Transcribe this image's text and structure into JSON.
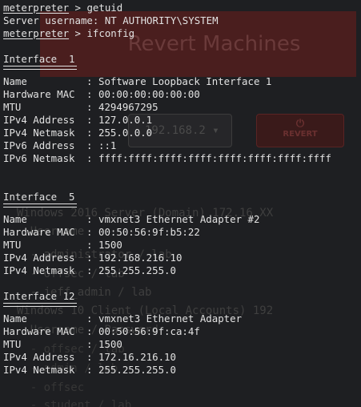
{
  "background": {
    "banner_title": "Revert Machines",
    "dropdown_value": "192.168.2",
    "revert_label": "REVERT",
    "lines": [
      "  Windows 2016 Server (Domain) 172.16.XX",
      "    Username",
      "    - administrator / lab",
      "    - offsec / lab",
      "    - jeff_admin / lab",
      "  Windows 10 Client (Local Accounts) 192",
      "    Username / Password",
      "    - offsec / lab",
      "    - admin / lab",
      "    - offsec",
      "    - student / lab"
    ],
    "colors": {
      "page": "#1e1f22",
      "banner": "#4a1e1e",
      "revert": "#3a1a1a"
    }
  },
  "terminal": {
    "prompt": "meterpreter",
    "commands": {
      "getuid": " > getuid",
      "ifconfig": " > ifconfig"
    },
    "getuid_output": "Server username: NT AUTHORITY\\SYSTEM",
    "separator": ": ",
    "interfaces": [
      {
        "title": "Interface  1",
        "rows": [
          {
            "key": "Name",
            "value": "Software Loopback Interface 1"
          },
          {
            "key": "Hardware MAC",
            "value": "00:00:00:00:00:00"
          },
          {
            "key": "MTU",
            "value": "4294967295"
          },
          {
            "key": "IPv4 Address",
            "value": "127.0.0.1"
          },
          {
            "key": "IPv4 Netmask",
            "value": "255.0.0.0"
          },
          {
            "key": "IPv6 Address",
            "value": "::1"
          },
          {
            "key": "IPv6 Netmask",
            "value": "ffff:ffff:ffff:ffff:ffff:ffff:ffff:ffff"
          }
        ]
      },
      {
        "title": "Interface  5",
        "rows": [
          {
            "key": "Name",
            "value": "vmxnet3 Ethernet Adapter #2"
          },
          {
            "key": "Hardware MAC",
            "value": "00:50:56:9f:b5:22"
          },
          {
            "key": "MTU",
            "value": "1500"
          },
          {
            "key": "IPv4 Address",
            "value": "192.168.216.10"
          },
          {
            "key": "IPv4 Netmask",
            "value": "255.255.255.0"
          }
        ]
      },
      {
        "title": "Interface 12",
        "rows": [
          {
            "key": "Name",
            "value": "vmxnet3 Ethernet Adapter"
          },
          {
            "key": "Hardware MAC",
            "value": "00:50:56:9f:ca:4f"
          },
          {
            "key": "MTU",
            "value": "1500"
          },
          {
            "key": "IPv4 Address",
            "value": "172.16.216.10"
          },
          {
            "key": "IPv4 Netmask",
            "value": "255.255.255.0"
          }
        ]
      }
    ],
    "colors": {
      "text": "#e2e2e2"
    }
  }
}
